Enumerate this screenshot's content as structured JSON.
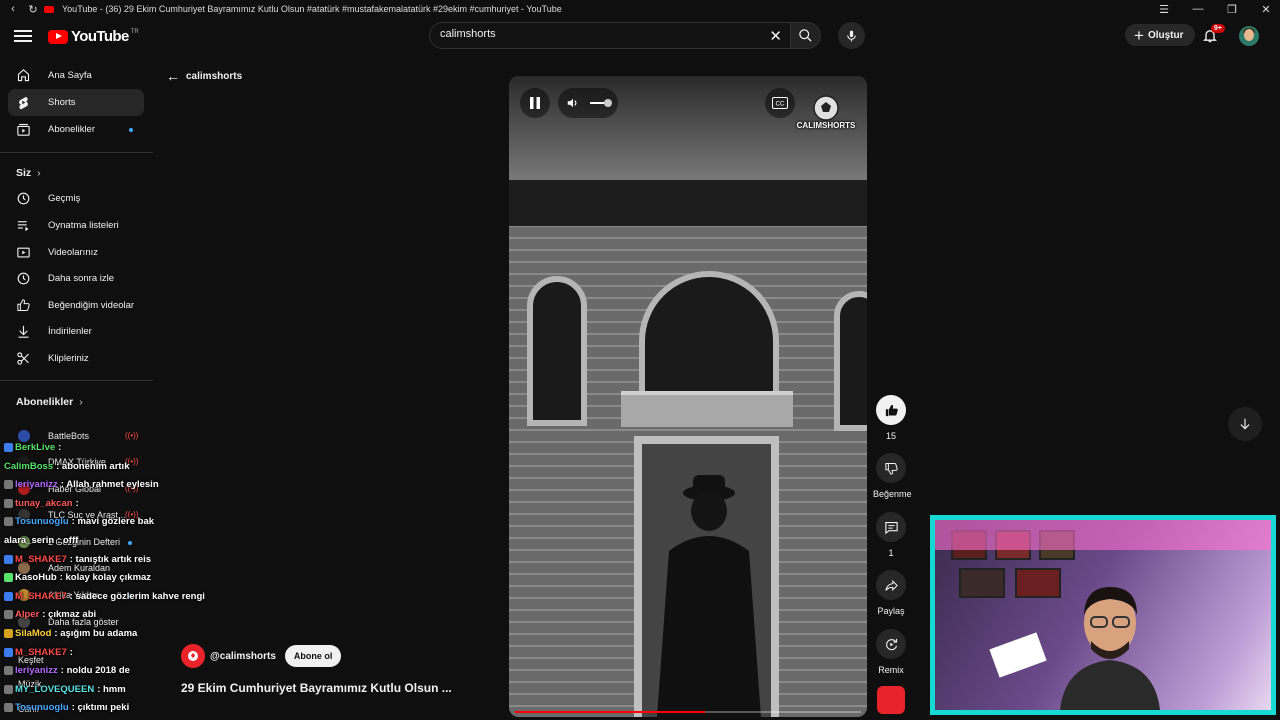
{
  "window": {
    "title": "YouTube - (36) 29 Ekim Cumhuriyet Bayramımız Kutlu Olsun #atatürk #mustafakemalatatürk #29ekim #cumhuriyet - YouTube"
  },
  "header": {
    "logo_text": "YouTube",
    "logo_region": "TR",
    "search_value": "calimshorts",
    "create_label": "Oluştur",
    "notif_badge": "9+"
  },
  "sidebar": {
    "main": [
      {
        "label": "Ana Sayfa",
        "icon": "home-icon"
      },
      {
        "label": "Shorts",
        "icon": "shorts-icon",
        "active": true
      },
      {
        "label": "Abonelikler",
        "icon": "subscriptions-icon",
        "dot": true
      }
    ],
    "you_header": "Siz",
    "you": [
      {
        "label": "Geçmiş",
        "icon": "history-icon"
      },
      {
        "label": "Oynatma listeleri",
        "icon": "playlist-icon"
      },
      {
        "label": "Videolarınız",
        "icon": "your-videos-icon"
      },
      {
        "label": "Daha sonra izle",
        "icon": "watch-later-icon"
      },
      {
        "label": "Beğendiğim videolar",
        "icon": "liked-icon"
      },
      {
        "label": "İndirilenler",
        "icon": "download-icon"
      },
      {
        "label": "Klipleriniz",
        "icon": "scissors-icon"
      }
    ],
    "subs_header": "Abonelikler",
    "subs": [
      {
        "label": "BattleBots",
        "live": true,
        "color": "#2b4da8"
      },
      {
        "label": "DMAX Türkiye",
        "live": true,
        "color": "#1a1a1a"
      },
      {
        "label": "Haber Global",
        "live": true,
        "color": "#b01c1c"
      },
      {
        "label": "TLC Suç ve Araşt...",
        "live": true,
        "color": "#333"
      },
      {
        "label": "2 Gezginin Defteri",
        "dot": true,
        "color": "#6a8a4a"
      },
      {
        "label": "Adem Kuraldan",
        "color": "#8a6a4a"
      },
      {
        "label": "Afrika Yıldızı",
        "dot": true,
        "color": "#c08a30"
      },
      {
        "label": "Daha fazla göster",
        "color": "#444"
      }
    ],
    "explore": [
      {
        "label": "Keşfet"
      },
      {
        "label": "Müzik"
      },
      {
        "label": "Canlı"
      }
    ]
  },
  "chat": [
    {
      "user": "BerkLive",
      "text": ":",
      "color": "#59e36c",
      "badge": "#3c7ef0"
    },
    {
      "user": "CalimBoss",
      "text": ": abonenim artık",
      "color": "#59e36c",
      "badge": ""
    },
    {
      "user": "leriyanizz",
      "text": ": Allah rahmet eylesin",
      "color": "#b26bff",
      "badge": "#777"
    },
    {
      "user": "tunay_akcan",
      "text": ":",
      "color": "#ff5a5a",
      "badge": "#777"
    },
    {
      "user": "Tosunuoglu",
      "text": ": mavi gözlere bak",
      "color": "#4aa8ff",
      "badge": "#777"
    },
    {
      "user": "alara_serin",
      "text": ": offf",
      "color": "#ffffff",
      "badge": ""
    },
    {
      "user": "M_SHAKE7",
      "text": ": tanıştık artık reis",
      "color": "#ff4b4b",
      "badge": "#3c7ef0"
    },
    {
      "user": "KasoHub",
      "text": ": kolay kolay çıkmaz",
      "color": "#ffffff",
      "badge": "#59e36c"
    },
    {
      "user": "M_SHAKE7",
      "text": ": sadece gözlerim kahve rengi",
      "color": "#ff4b4b",
      "badge": "#3c7ef0"
    },
    {
      "user": "Alper",
      "text": ": çıkmaz abi",
      "color": "#ff5a5a",
      "badge": "#777"
    },
    {
      "user": "SilaMod",
      "text": ": aşığım bu adama",
      "color": "#ffd23d",
      "badge": "#d6a21e"
    },
    {
      "user": "M_SHAKE7",
      "text": ":",
      "color": "#ff4b4b",
      "badge": "#3c7ef0"
    },
    {
      "user": "leriyanizz",
      "text": ": noldu 2018 de",
      "color": "#b26bff",
      "badge": "#777"
    },
    {
      "user": "MY_LOVEQUEEN",
      "text": ": hmm",
      "color": "#59e3e3",
      "badge": "#777"
    },
    {
      "user": "Tosunuoglu",
      "text": ": çıktımı peki",
      "color": "#4aa8ff",
      "badge": "#777"
    }
  ],
  "content": {
    "back_label": "calimshorts",
    "watermark": "CALIMSHORTS",
    "progress": 0.55,
    "channel_handle": "@calimshorts",
    "subscribe_label": "Abone ol",
    "title": "29 Ekim Cumhuriyet Bayramımız Kutlu Olsun ..."
  },
  "actions": {
    "like_count": "15",
    "dislike_label": "Beğenme",
    "comment_count": "1",
    "share_label": "Paylaş",
    "remix_label": "Remix"
  },
  "colors": {
    "accent": "#ff0000",
    "webcam_border": "#17d9d4"
  }
}
